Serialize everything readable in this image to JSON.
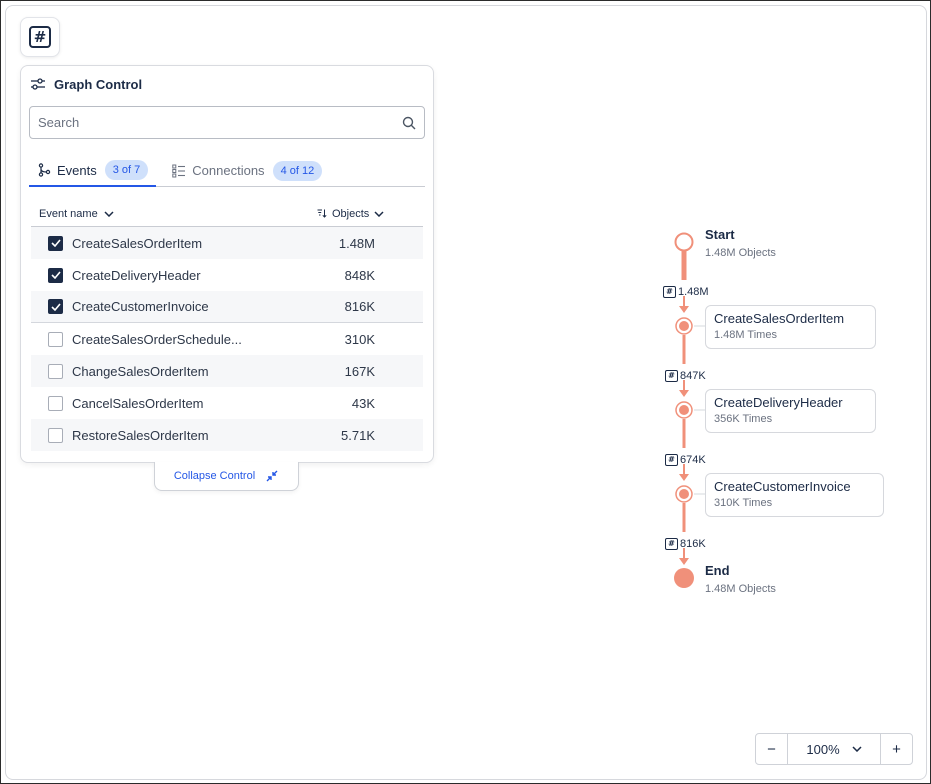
{
  "toolbar": {
    "hash_icon": "hash-icon"
  },
  "panel": {
    "title": "Graph Control",
    "title_icon": "sliders-icon",
    "search": {
      "placeholder": "Search",
      "value": "",
      "icon": "search-icon"
    },
    "tabs": [
      {
        "label": "Events",
        "count": "3 of 7",
        "icon": "branch-icon",
        "active": true
      },
      {
        "label": "Connections",
        "count": "4 of 12",
        "icon": "list-icon",
        "active": false
      }
    ],
    "table": {
      "col_name": "Event name",
      "col_objects": "Objects",
      "rows": [
        {
          "name": "CreateSalesOrderItem",
          "value": "1.48M",
          "checked": true
        },
        {
          "name": "CreateDeliveryHeader",
          "value": "848K",
          "checked": true
        },
        {
          "name": "CreateCustomerInvoice",
          "value": "816K",
          "checked": true
        },
        {
          "name": "CreateSalesOrderSchedule...",
          "value": "310K",
          "checked": false
        },
        {
          "name": "ChangeSalesOrderItem",
          "value": "167K",
          "checked": false
        },
        {
          "name": "CancelSalesOrderItem",
          "value": "43K",
          "checked": false
        },
        {
          "name": "RestoreSalesOrderItem",
          "value": "5.71K",
          "checked": false
        }
      ]
    },
    "collapse_label": "Collapse Control"
  },
  "graph": {
    "accent": "#f0907a",
    "start": {
      "title": "Start",
      "sub": "1.48M Objects"
    },
    "end": {
      "title": "End",
      "sub": "1.48M Objects"
    },
    "edges": [
      "1.48M",
      "847K",
      "674K",
      "816K"
    ],
    "nodes": [
      {
        "title": "CreateSalesOrderItem",
        "sub": "1.48M Times"
      },
      {
        "title": "CreateDeliveryHeader",
        "sub": "356K Times"
      },
      {
        "title": "CreateCustomerInvoice",
        "sub": "310K Times"
      }
    ]
  },
  "zoom": {
    "minus": "−",
    "value": "100%",
    "plus": "+"
  }
}
